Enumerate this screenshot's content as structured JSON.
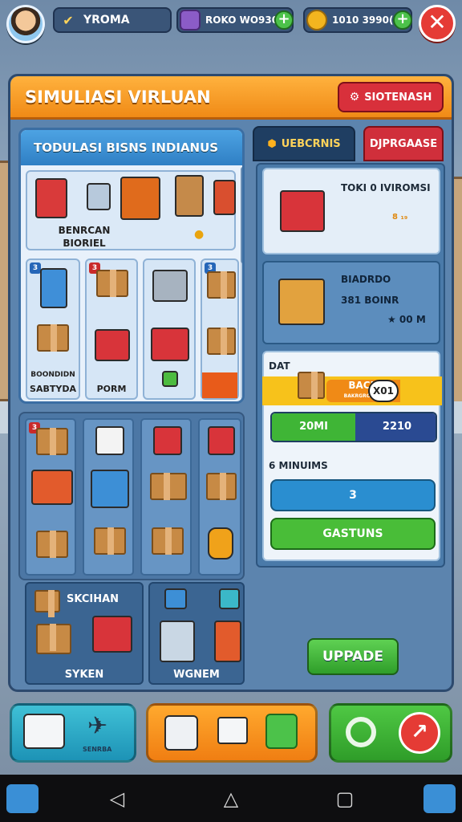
{
  "topbar": {
    "player_name": "YROMA",
    "currency1": "ROKO WO930",
    "currency2": "1010 3990(",
    "plus": "+",
    "close": "✕"
  },
  "panel": {
    "title": "SIMULIASI VIRLUAN",
    "header_button": "SIOTENASH"
  },
  "left": {
    "title": "TODULASI BISNS INDIANUS",
    "shop_label_1": "BENRCAN",
    "shop_label_2": "BIORIEL",
    "label_sabtyda": "SABTYDA",
    "label_small": "BOONDIDN",
    "label_porm": "PORM",
    "badges": [
      "3",
      "3",
      "3"
    ],
    "card1_title": "SKCIHAN",
    "card1_sub": "SYKEN",
    "card2_sub": "WGNEM"
  },
  "right": {
    "tab_active": "UEBCRNIS",
    "tab_other": "DJPRGAASE",
    "item1_title": "TOKI 0 IVIROMSI",
    "item1_price": "8 ₁₉",
    "item2_title": "BIADRDO",
    "item2_sub": "381 BOINR",
    "item2_stars": "★ 00 M",
    "dat_label": "DAT",
    "bach_label": "BACH",
    "bach_sub": "BAKRGROTIRB",
    "bach_count": "X01",
    "split_left": "20MI",
    "split_right": "2210",
    "minuims": "6 MINUIMS",
    "blue_btn": "3",
    "green_btn": "GASTUNS"
  },
  "upgrade": "UPPADE",
  "bottom": {
    "b1_label": "SENRBA"
  },
  "colors": {
    "accent_orange": "#f08a16",
    "accent_red": "#d8303b",
    "accent_green": "#3fb536",
    "accent_blue": "#2f7fc4"
  }
}
